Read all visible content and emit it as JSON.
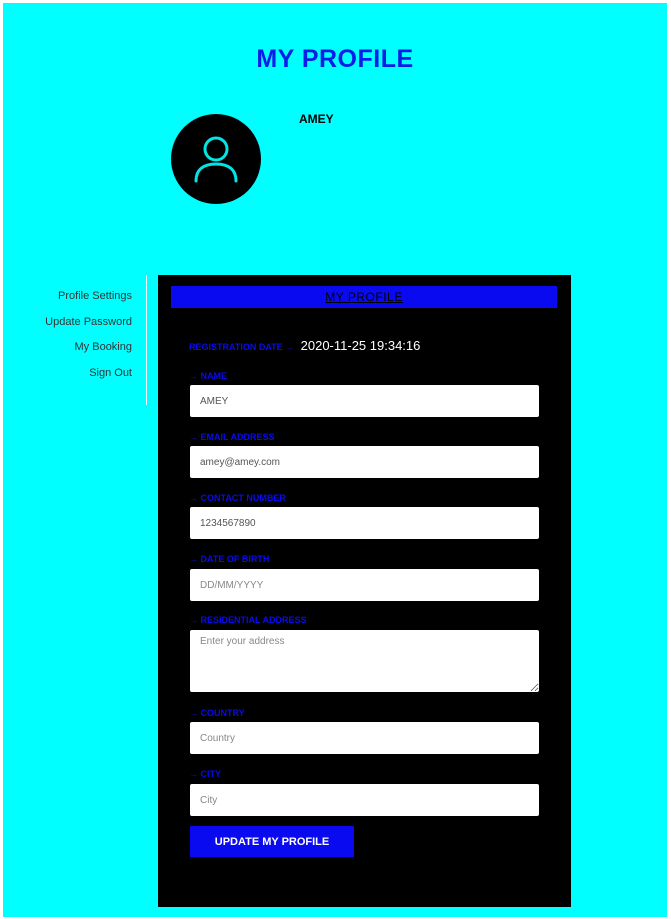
{
  "page": {
    "title": "MY PROFILE",
    "username": "AMEY"
  },
  "sidebar": {
    "items": [
      {
        "label": "Profile Settings"
      },
      {
        "label": "Update Password"
      },
      {
        "label": "My Booking"
      },
      {
        "label": "Sign Out"
      }
    ]
  },
  "form": {
    "header": "MY PROFILE",
    "registration_label": "REGISTRATION DATE →",
    "registration_value": "2020-11-25 19:34:16",
    "name": {
      "label": "→ NAME",
      "value": "AMEY"
    },
    "email": {
      "label": "→ EMAIL ADDRESS",
      "value": "amey@amey.com"
    },
    "contact": {
      "label": "→ CONTACT NUMBER",
      "value": "1234567890"
    },
    "dob": {
      "label": "→ DATE OF BIRTH",
      "placeholder": "DD/MM/YYYY"
    },
    "address": {
      "label": "→ RESIDENTIAL ADDRESS",
      "placeholder": "Enter your address"
    },
    "country": {
      "label": "→ COUNTRY",
      "placeholder": "Country"
    },
    "city": {
      "label": "→ CITY",
      "placeholder": "City"
    },
    "submit_label": "UPDATE MY PROFILE"
  },
  "colors": {
    "background": "#00ffff",
    "accent": "#0a0af0",
    "panel": "#000000",
    "avatar_icon": "#00e5e5"
  },
  "icons": {
    "avatar": "user-icon"
  }
}
